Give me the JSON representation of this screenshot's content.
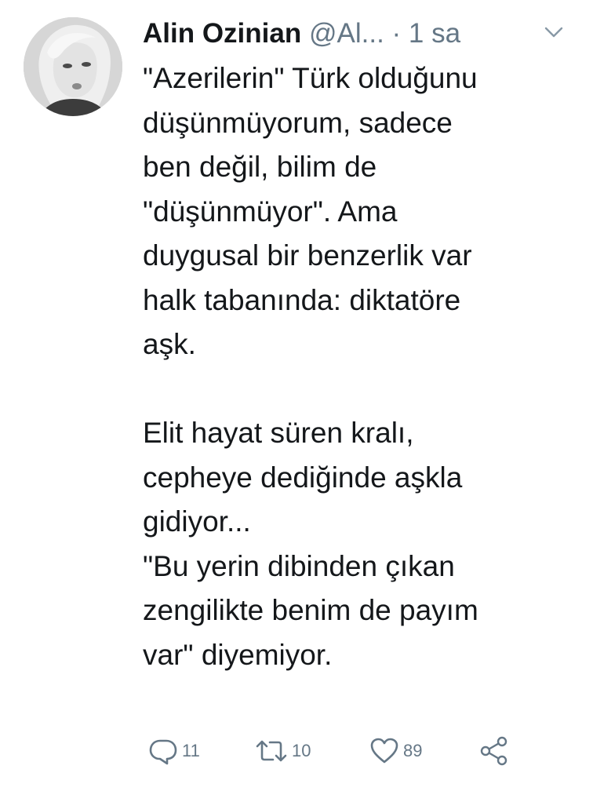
{
  "tweet": {
    "author_name": "Alin Ozinian",
    "handle": "@Al...",
    "separator": "·",
    "time": "1 sa",
    "lines": [
      "\"Azerilerin\" Türk olduğunu",
      "düşünmüyorum, sadece",
      "ben değil, bilim de",
      "\"düşünmüyor\". Ama",
      "duygusal bir benzerlik var",
      "halk tabanında: diktatöre",
      "aşk.",
      "",
      "Elit hayat süren kralı,",
      "cepheye dediğinde aşkla",
      "gidiyor...",
      "\"Bu yerin dibinden çıkan",
      "zengilikte benim de payım",
      "var\" diyemiyor."
    ],
    "reply_count": "11",
    "retweet_count": "10",
    "like_count": "89"
  },
  "icons": {
    "menu": "chevron-down-icon",
    "reply": "reply-icon",
    "retweet": "retweet-icon",
    "like": "heart-icon",
    "share": "share-icon"
  },
  "colors": {
    "text": "#14171a",
    "secondary": "#657786",
    "background": "#ffffff"
  }
}
